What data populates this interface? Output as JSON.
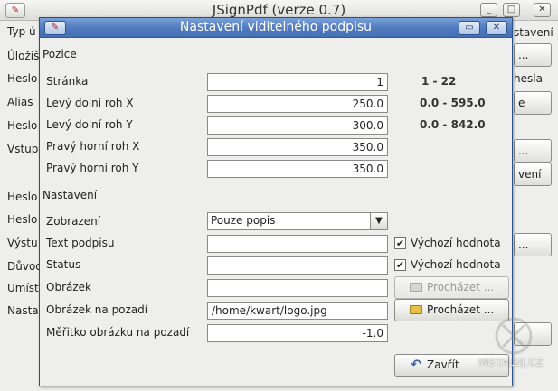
{
  "main_window": {
    "title": "JSignPdf (verze 0.7)",
    "labels": [
      "Typ ú",
      "Úložiš",
      "Heslo",
      "Alias",
      "Heslo",
      "Vstup",
      "Heslo",
      "Heslo",
      "Výstu",
      "Důvod",
      "Umíst",
      "Nasta"
    ],
    "right_labels": [
      "stavení",
      "hesla",
      "vení"
    ],
    "right_buttons": [
      " ...",
      "e",
      " ...",
      " ...",
      ""
    ],
    "controls": {
      "minimize": "_",
      "maximize": "□",
      "close": "✕"
    }
  },
  "dialog": {
    "title": "Nastavení viditelného podpisu",
    "controls": {
      "minimize": "▭",
      "close": "✕"
    },
    "position_section": {
      "label": "Pozice",
      "rows": [
        {
          "label": "Stránka",
          "value": "1",
          "range": "1 - 22"
        },
        {
          "label": "Levý dolní roh X",
          "value": "250.0",
          "range": "0.0 - 595.0"
        },
        {
          "label": "Levý dolní roh Y",
          "value": "300.0",
          "range": "0.0 - 842.0"
        },
        {
          "label": "Pravý horní roh X",
          "value": "350.0",
          "range": ""
        },
        {
          "label": "Pravý horní roh Y",
          "value": "350.0",
          "range": ""
        }
      ]
    },
    "settings_section": {
      "label": "Nastavení",
      "display": {
        "label": "Zobrazení",
        "selected": "Pouze popis"
      },
      "signature_text": {
        "label": "Text podpisu",
        "value": "",
        "checkbox_label": "Výchozí hodnota",
        "checked": true
      },
      "status": {
        "label": "Status",
        "value": "",
        "checkbox_label": "Výchozí hodnota",
        "checked": true
      },
      "image": {
        "label": "Obrázek",
        "value": "",
        "browse_label": "Procházet ...",
        "enabled": false
      },
      "background_image": {
        "label": "Obrázek na pozadí",
        "value": "/home/kwart/logo.jpg",
        "browse_label": "Procházet ...",
        "enabled": true
      },
      "background_scale": {
        "label": "Měřitko obrázku na pozadí",
        "value": "-1.0"
      }
    },
    "close_button": "Zavřít"
  },
  "watermark": "INSTALUJ.CZ"
}
